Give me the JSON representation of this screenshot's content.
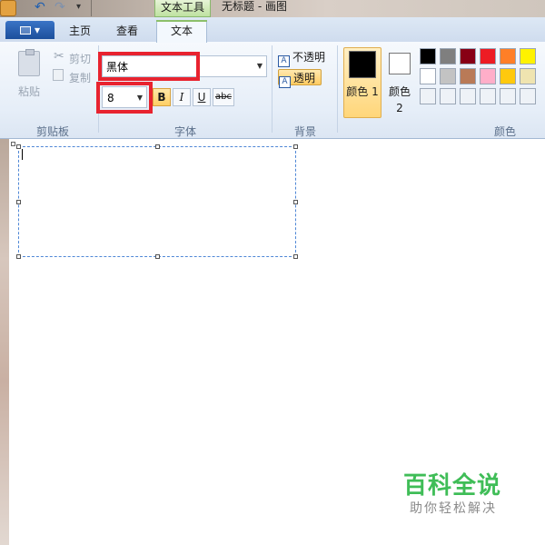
{
  "titlebar": {
    "contextual_tab": "文本工具",
    "window_title": "无标题 - 画图"
  },
  "tabs": {
    "home": "主页",
    "view": "查看",
    "text": "文本"
  },
  "clipboard": {
    "paste": "粘贴",
    "cut": "剪切",
    "copy": "复制",
    "group_label": "剪贴板"
  },
  "font": {
    "family": "黑体",
    "size": "8",
    "bold": "B",
    "italic": "I",
    "underline": "U",
    "strike": "abc",
    "group_label": "字体"
  },
  "background": {
    "opaque": "不透明",
    "transparent": "透明",
    "opaque_icon": "A",
    "transparent_icon": "A",
    "group_label": "背景"
  },
  "colors": {
    "color1_label": "颜色 1",
    "color2_label": "颜色 2",
    "group_label": "颜色",
    "color1_value": "#000000",
    "color2_value": "#ffffff",
    "palette": [
      [
        "#000000",
        "#7f7f7f",
        "#880015",
        "#ed1c24",
        "#ff7f27",
        "#fff200"
      ],
      [
        "#ffffff",
        "#c3c3c3",
        "#b97a57",
        "#ffaec9",
        "#ffc90e",
        "#efe4b0"
      ],
      [
        "#eef2f7",
        "#eef2f7",
        "#eef2f7",
        "#eef2f7",
        "#eef2f7",
        "#eef2f7"
      ]
    ]
  },
  "watermark": {
    "title": "百科全说",
    "subtitle": "助你轻松解决"
  }
}
